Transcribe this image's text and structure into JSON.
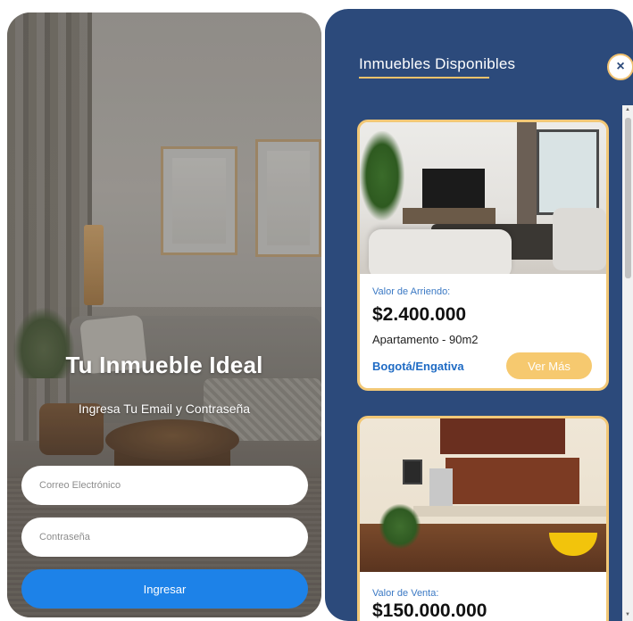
{
  "login": {
    "title": "Tu Inmueble Ideal",
    "subtitle": "Ingresa Tu Email y Contraseña",
    "email_placeholder": "Correo Electrónico",
    "password_placeholder": "Contraseña",
    "submit_label": "Ingresar"
  },
  "panel": {
    "title": "Inmuebles Disponibles",
    "close_icon": "×",
    "accent_color": "#f3c36b",
    "background_color": "#2c4a7b",
    "cards": [
      {
        "image": "living-room-photo",
        "price_label": "Valor de Arriendo:",
        "price": "$2.400.000",
        "type": "Apartamento - 90m2",
        "city": "Bogotá/Engativa",
        "more_label": "Ver Más"
      },
      {
        "image": "kitchen-photo",
        "price_label": "Valor de Venta:",
        "price": "$150.000.000"
      }
    ]
  }
}
